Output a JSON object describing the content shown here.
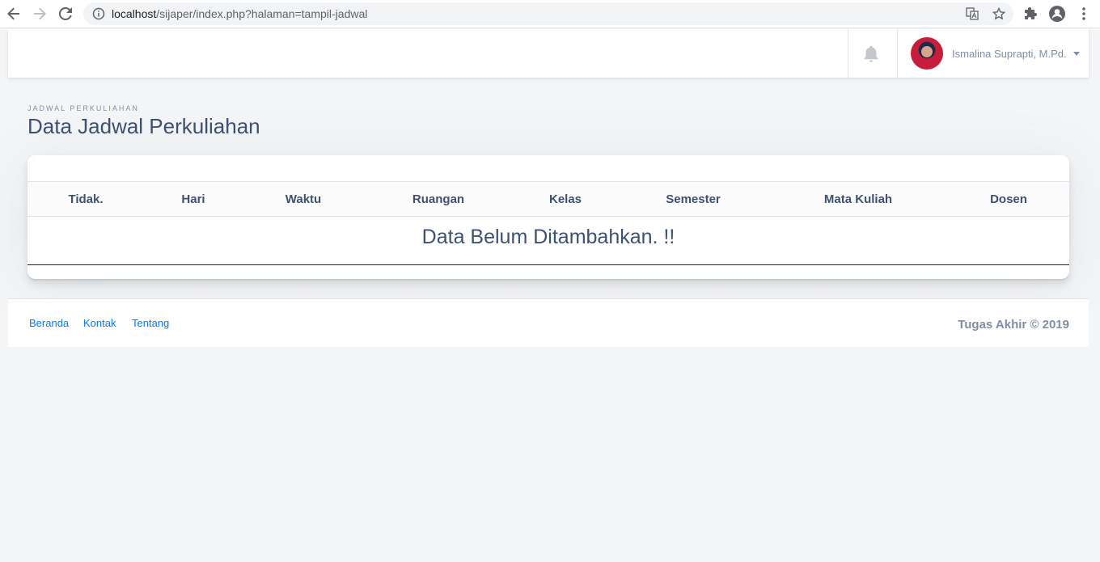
{
  "browser": {
    "url_host": "localhost",
    "url_path": "/sijaper/index.php?halaman=tampil-jadwal",
    "icons": [
      "back-arrow-icon",
      "forward-arrow-icon",
      "reload-icon",
      "info-icon",
      "translate-icon",
      "star-icon",
      "puzzle-icon",
      "profile-icon",
      "kebab-menu-icon"
    ]
  },
  "navbar": {
    "user_name": "Ismalina Suprapti, M.Pd."
  },
  "page": {
    "subtitle": "JADWAL PERKULIAHAN",
    "title": "Data Jadwal Perkuliahan"
  },
  "table": {
    "columns": [
      "Tidak.",
      "Hari",
      "Waktu",
      "Ruangan",
      "Kelas",
      "Semester",
      "Mata Kuliah",
      "Dosen"
    ],
    "empty_message": "Data Belum Ditambahkan. !!"
  },
  "footer": {
    "links": [
      "Beranda",
      "Kontak",
      "Tentang"
    ],
    "copyright": "Tugas Akhir © 2019"
  },
  "colors": {
    "accent": "#007bff",
    "text": "#3d5170",
    "muted": "#818ea3",
    "background": "#f4f5f7"
  }
}
